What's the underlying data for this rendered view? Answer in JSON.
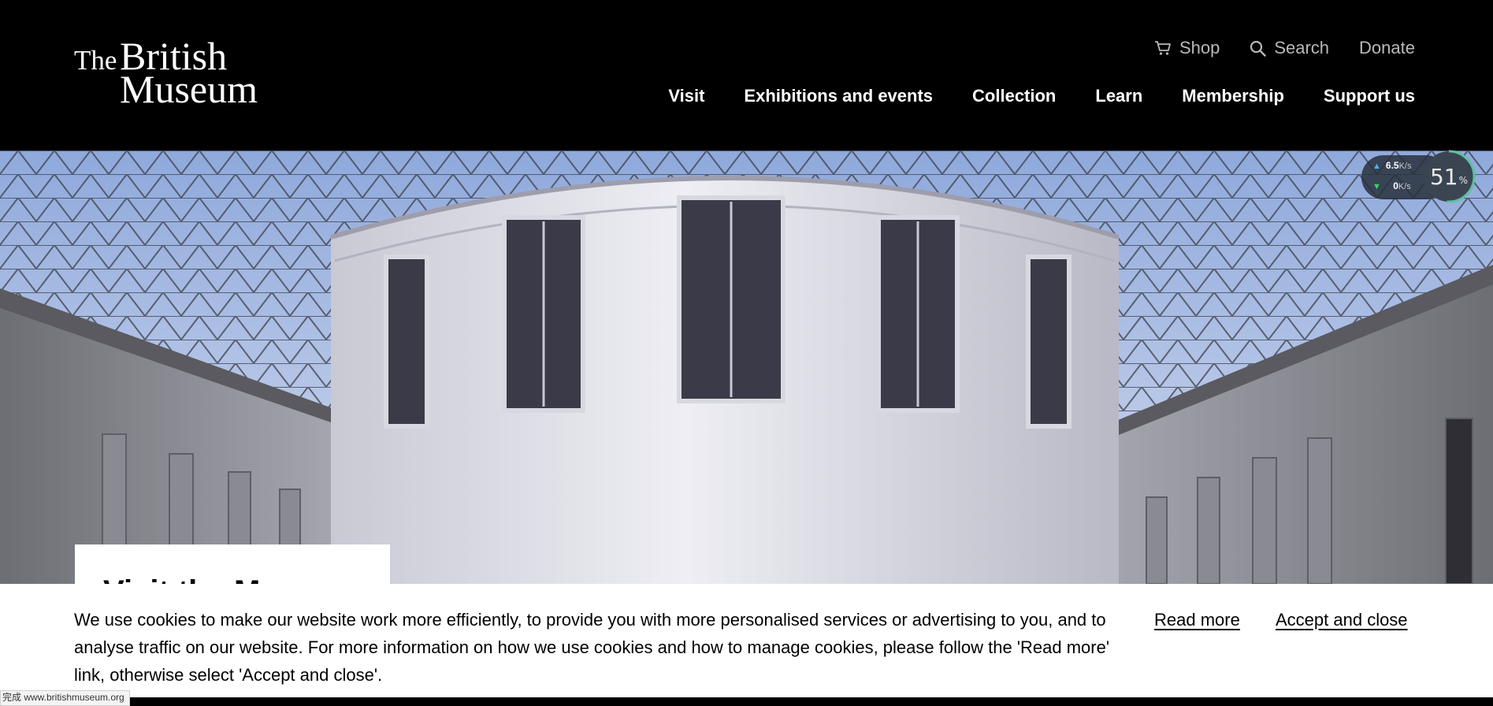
{
  "header": {
    "logo": {
      "the": "The",
      "british": "British",
      "museum": "Museum"
    },
    "utility_nav": [
      {
        "label": "Shop",
        "icon": "cart-icon"
      },
      {
        "label": "Search",
        "icon": "search-icon"
      },
      {
        "label": "Donate"
      }
    ],
    "main_nav": [
      {
        "label": "Visit"
      },
      {
        "label": "Exhibitions and events"
      },
      {
        "label": "Collection"
      },
      {
        "label": "Learn"
      },
      {
        "label": "Membership"
      },
      {
        "label": "Support us"
      }
    ]
  },
  "hero": {
    "card_title": "Visit the Museum"
  },
  "speed_widget": {
    "upload": "6.5",
    "upload_unit": "K/s",
    "download": "0",
    "download_unit": "K/s",
    "percent": "51",
    "percent_sign": "%"
  },
  "cookie_banner": {
    "message": "We use cookies to make our website work more efficiently, to provide you with more personalised services or advertising to you, and to analyse traffic on our website. For more information on how we use cookies and how to manage cookies, please follow the 'Read more' link, otherwise select 'Accept and close'.",
    "read_more": "Read more",
    "accept": "Accept and close"
  },
  "status_bar": {
    "text": "完成 www.britishmuseum.org"
  },
  "colors": {
    "header_bg": "#000000",
    "utility_text": "#b8b8b8",
    "nav_text": "#ffffff",
    "banner_bg": "#ffffff"
  }
}
